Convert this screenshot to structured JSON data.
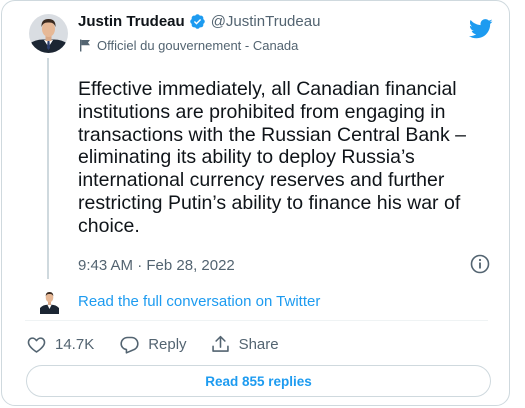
{
  "author": {
    "display_name": "Justin Trudeau",
    "handle": "@JustinTrudeau",
    "label": "Officiel du gouvernement - Canada",
    "avatar_icon": "profile-photo-avatar",
    "verified_icon": "verified-badge-icon"
  },
  "tweet": {
    "text": "Effective immediately, all Canadian financial institutions are prohibited from engaging in transactions with the Russian Central Bank – eliminating its ability to deploy Russia’s international currency reserves and further restricting Putin’s ability to finance his war of choice.",
    "timestamp": "9:43 AM · Feb 28, 2022"
  },
  "conversation": {
    "link_text": "Read the full conversation on Twitter"
  },
  "actions": {
    "like_count": "14.7K",
    "reply_label": "Reply",
    "share_label": "Share"
  },
  "replies_button": {
    "label": "Read 855 replies"
  },
  "colors": {
    "accent": "#1d9bf0",
    "text": "#0f1419",
    "secondary": "#536471",
    "border": "#cfd9de"
  }
}
